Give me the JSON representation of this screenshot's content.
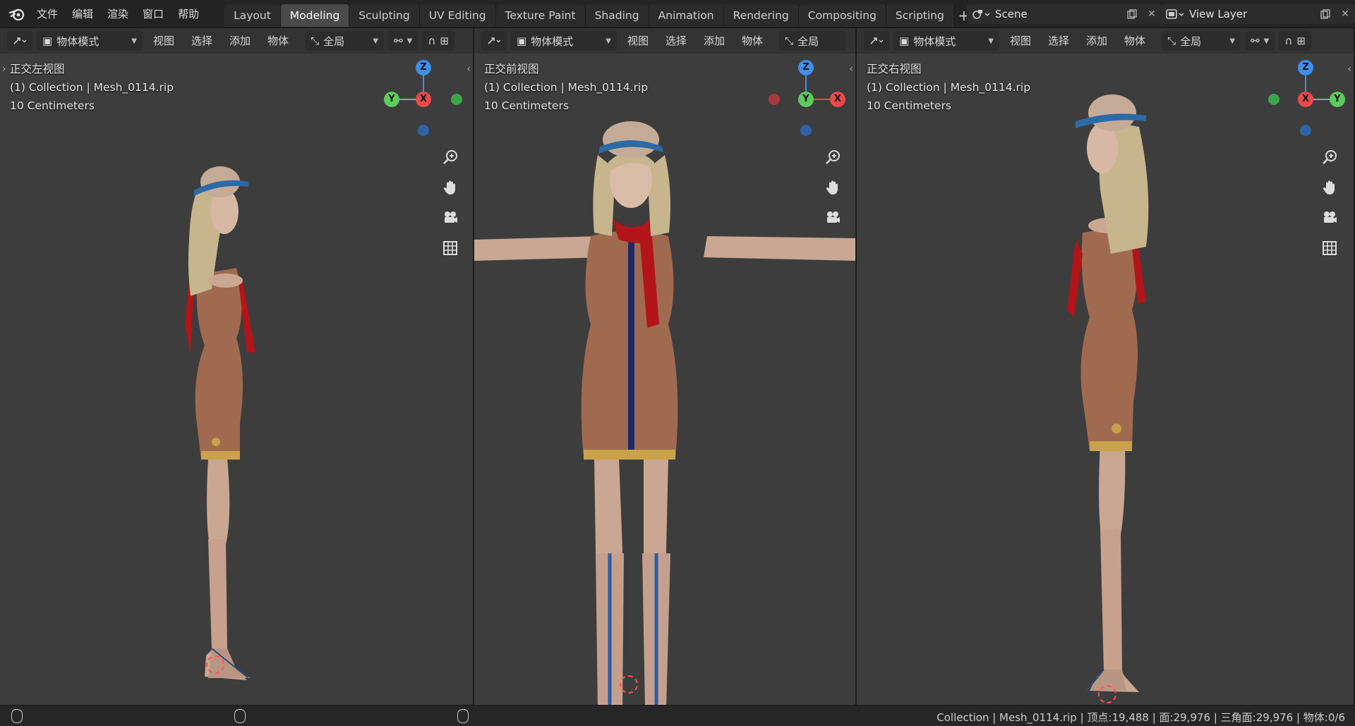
{
  "menu": [
    "文件",
    "编辑",
    "渲染",
    "窗口",
    "帮助"
  ],
  "workspaces": [
    {
      "label": "Layout",
      "active": false
    },
    {
      "label": "Modeling",
      "active": true
    },
    {
      "label": "Sculpting",
      "active": false
    },
    {
      "label": "UV Editing",
      "active": false
    },
    {
      "label": "Texture Paint",
      "active": false
    },
    {
      "label": "Shading",
      "active": false
    },
    {
      "label": "Animation",
      "active": false
    },
    {
      "label": "Rendering",
      "active": false
    },
    {
      "label": "Compositing",
      "active": false
    },
    {
      "label": "Scripting",
      "active": false
    }
  ],
  "scene": {
    "label": "Scene"
  },
  "view_layer": {
    "label": "View Layer"
  },
  "viewports": {
    "left": {
      "mode": "物体模式",
      "menus": [
        "视图",
        "选择",
        "添加",
        "物体"
      ],
      "orientation": "全局",
      "view_name": "正交左视图",
      "collection": "(1) Collection | Mesh_0114.rip",
      "scale": "10 Centimeters"
    },
    "front": {
      "mode": "物体模式",
      "menus": [
        "视图",
        "选择",
        "添加",
        "物体"
      ],
      "orientation": "全局",
      "view_name": "正交前视图",
      "collection": "(1) Collection | Mesh_0114.rip",
      "scale": "10 Centimeters"
    },
    "right": {
      "mode": "物体模式",
      "menus": [
        "视图",
        "选择",
        "添加",
        "物体"
      ],
      "orientation": "全局",
      "view_name": "正交右视图",
      "collection": "(1) Collection | Mesh_0114.rip",
      "scale": "10 Centimeters"
    }
  },
  "gizmo_axes": {
    "z": "Z",
    "y": "Y",
    "x": "X"
  },
  "status_bar": "Collection | Mesh_0114.rip | 顶点:19,488 | 面:29,976 | 三角面:29,976 | 物体:0/6",
  "colors": {
    "axis_x": "#e84a4a",
    "axis_y": "#5ccb5f",
    "axis_z": "#3f8fe8",
    "active_tab": "#4a4a4a",
    "viewport_bg": "#3d3d3d"
  }
}
